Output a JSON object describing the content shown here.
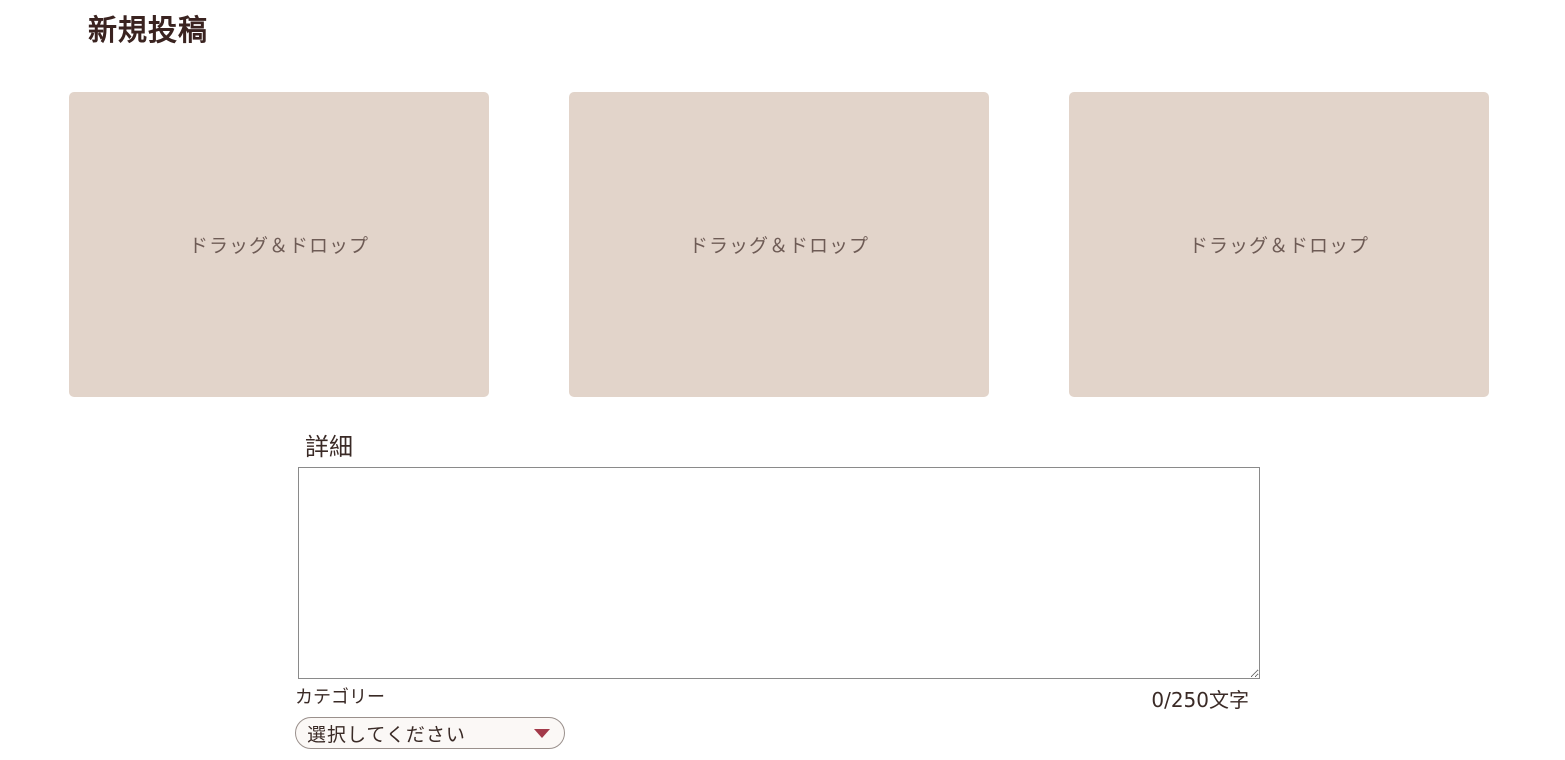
{
  "page": {
    "title": "新規投稿"
  },
  "dropzones": [
    {
      "label": "ドラッグ＆ドロップ"
    },
    {
      "label": "ドラッグ＆ドロップ"
    },
    {
      "label": "ドラッグ＆ドロップ"
    }
  ],
  "detail": {
    "label": "詳細",
    "value": "",
    "counter": "0/250文字"
  },
  "category": {
    "label": "カテゴリー",
    "selected": "選択してください"
  },
  "colors": {
    "dropzone_bg": "#e2d4ca",
    "title_text": "#3a2320",
    "select_arrow": "#a33a4a"
  }
}
